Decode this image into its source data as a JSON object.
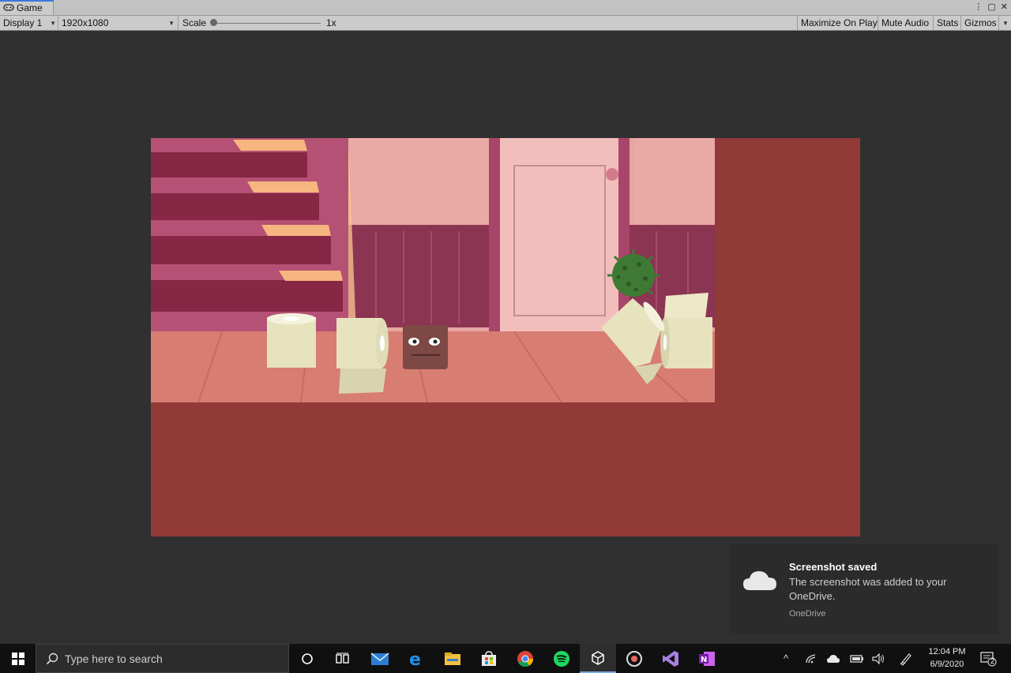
{
  "window": {
    "tab_title": "Game"
  },
  "toolbar": {
    "display": "Display 1",
    "resolution": "1920x1080",
    "scale_label": "Scale",
    "scale_value": "1x",
    "maximize_on_play": "Maximize On Play",
    "mute_audio": "Mute Audio",
    "stats": "Stats",
    "gizmos": "Gizmos"
  },
  "colors": {
    "letterbox": "#923a37",
    "editor_bg": "#303030"
  },
  "notification": {
    "title": "Screenshot saved",
    "body": "The screenshot was added to your OneDrive.",
    "app": "OneDrive"
  },
  "taskbar": {
    "search_placeholder": "Type here to search",
    "apps": [
      "cortana-icon",
      "task-view-icon",
      "mail-icon",
      "edge-icon",
      "file-explorer-icon",
      "store-icon",
      "chrome-icon",
      "spotify-icon",
      "unity-icon",
      "media-icon",
      "visual-studio-icon",
      "onenote-icon"
    ],
    "time": "12:04 PM",
    "date": "6/9/2020",
    "notifications_count": "2"
  }
}
